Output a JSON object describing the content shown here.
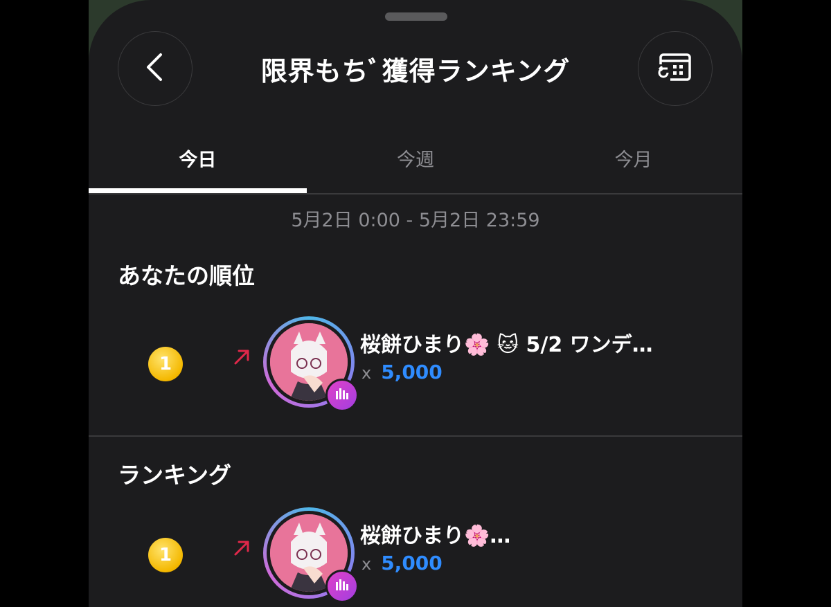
{
  "header": {
    "title": "限界もちﾞ獲得ランキング",
    "back_icon": "chevron-left-icon",
    "calendar_icon": "calendar-history-icon"
  },
  "tabs": [
    {
      "label": "今日",
      "active": true
    },
    {
      "label": "今週",
      "active": false
    },
    {
      "label": "今月",
      "active": false
    }
  ],
  "period": "5月2日 0:00 - 5月2日 23:59",
  "my_rank": {
    "section_title": "あなたの順位",
    "rank": "1",
    "name": "桜餅ひまり🌸 🐱 5/2 ワンデ…",
    "count_prefix": "x",
    "count": "5,000"
  },
  "ranking": {
    "section_title": "ランキング",
    "items": [
      {
        "rank": "1",
        "name": "桜餅ひまり🌸…",
        "count_prefix": "x",
        "count": "5,000"
      }
    ]
  },
  "colors": {
    "accent_blue": "#2f8cff",
    "trend_red": "#e0284a",
    "medal_gold": "#f4b800",
    "live_badge": "#d041d0"
  }
}
